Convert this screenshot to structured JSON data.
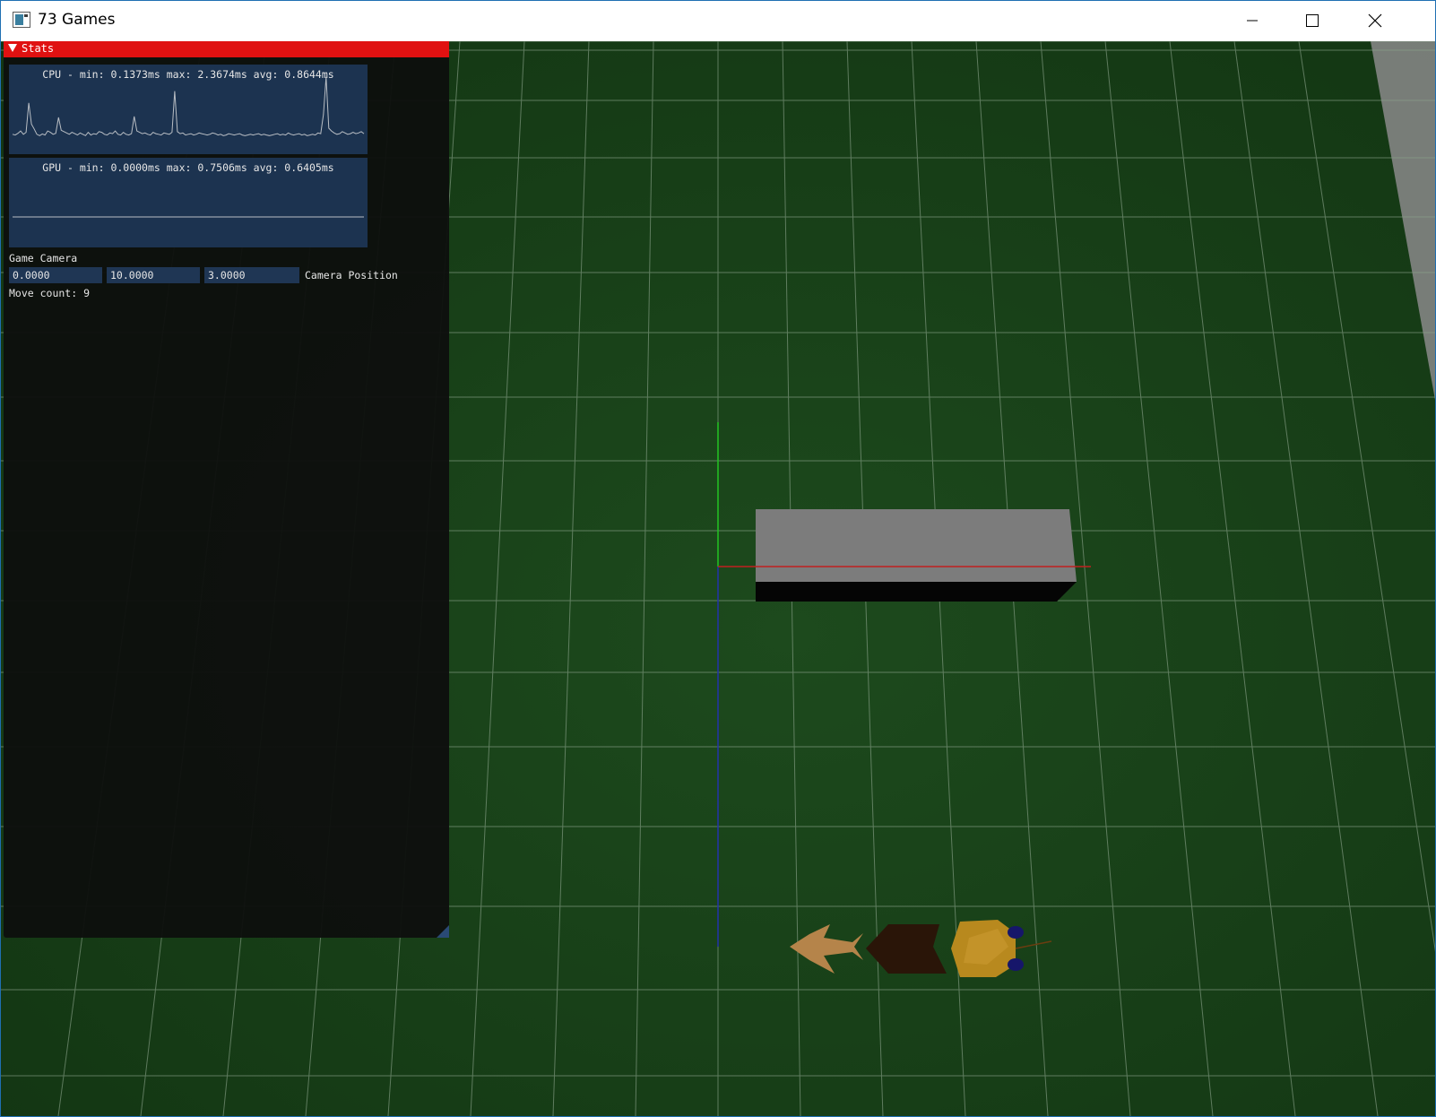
{
  "window": {
    "title": "73 Games"
  },
  "stats_panel": {
    "title": "Stats",
    "cpu_label": "CPU - min: 0.1373ms max: 2.3674ms avg: 0.8644ms",
    "gpu_label": "GPU - min: 0.0000ms max: 0.7506ms avg: 0.6405ms",
    "section_label": "Game Camera",
    "camera_position": {
      "x": "0.0000",
      "y": "10.0000",
      "z": "3.0000",
      "label": "Camera Position"
    },
    "move_count": "Move count: 9"
  },
  "chart_data": [
    {
      "type": "line",
      "title": "CPU - min: 0.1373ms max: 2.3674ms avg: 0.8644ms",
      "y_unit": "ms",
      "ylim": [
        0.1373,
        2.3674
      ],
      "values": [
        0.62,
        0.6,
        0.65,
        0.72,
        0.62,
        0.68,
        1.55,
        0.92,
        0.78,
        0.62,
        0.58,
        0.63,
        0.6,
        0.72,
        0.68,
        0.62,
        0.65,
        1.12,
        0.74,
        0.7,
        0.66,
        0.62,
        0.68,
        0.64,
        0.6,
        0.66,
        0.62,
        0.58,
        0.68,
        0.6,
        0.64,
        0.62,
        0.7,
        0.68,
        0.62,
        0.6,
        0.66,
        0.64,
        0.72,
        0.62,
        0.6,
        0.68,
        0.62,
        0.6,
        0.64,
        1.15,
        0.72,
        0.68,
        0.64,
        0.66,
        0.62,
        0.6,
        0.68,
        0.64,
        0.62,
        0.6,
        0.66,
        0.64,
        0.62,
        0.68,
        1.9,
        0.7,
        0.64,
        0.66,
        0.6,
        0.62,
        0.64,
        0.6,
        0.62,
        0.66,
        0.64,
        0.62,
        0.6,
        0.62,
        0.66,
        0.64,
        0.6,
        0.62,
        0.58,
        0.6,
        0.64,
        0.62,
        0.6,
        0.62,
        0.64,
        0.6,
        0.58,
        0.6,
        0.62,
        0.6,
        0.62,
        0.64,
        0.6,
        0.62,
        0.6,
        0.58,
        0.6,
        0.62,
        0.64,
        0.6,
        0.62,
        0.6,
        0.66,
        0.62,
        0.6,
        0.62,
        0.64,
        0.6,
        0.62,
        0.58,
        0.6,
        0.62,
        0.6,
        0.66,
        0.64,
        1.2,
        2.32,
        0.8,
        0.72,
        0.66,
        0.62,
        0.64,
        0.7,
        0.66,
        0.62,
        0.64,
        0.68,
        0.64,
        0.66,
        0.7,
        0.64
      ]
    },
    {
      "type": "line",
      "title": "GPU - min: 0.0000ms max: 0.7506ms avg: 0.6405ms",
      "y_unit": "ms",
      "ylim": [
        0.0,
        0.7506
      ],
      "values_constant": 0.0
    }
  ]
}
